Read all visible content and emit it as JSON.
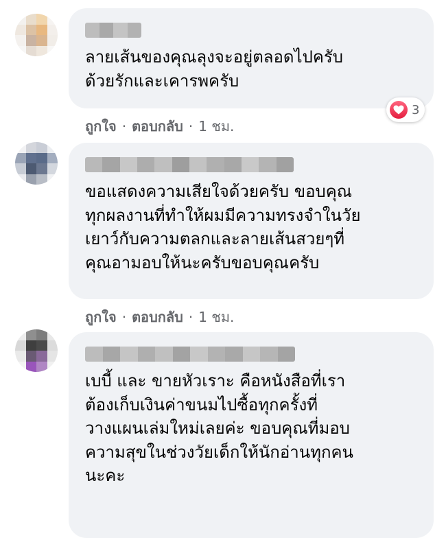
{
  "comments": [
    {
      "text": "ลายเส้นของคุณลุงจะอยู่ตลอดไปครับ\nด้วยรักและเคารพครับ",
      "reaction": {
        "icon": "heart-icon",
        "count": "3",
        "color": "#e41e3f"
      },
      "actions": {
        "like": "ถูกใจ",
        "sep1": "·",
        "reply": "ตอบกลับ",
        "sep2": "·",
        "time": "1 ชม."
      }
    },
    {
      "text": "ขอแสดงความเสียใจด้วยครับ ขอบคุณ\nทุกผลงานที่ทำให้ผมมีความทรงจำในวัย\nเยาว์กับความตลกและลายเส้นสวยๆที่\nคุณอามอบให้นะครับขอบคุณครับ",
      "actions": {
        "like": "ถูกใจ",
        "sep1": "·",
        "reply": "ตอบกลับ",
        "sep2": "·",
        "time": "1 ชม."
      }
    },
    {
      "text": "เบบี้ และ ขายหัวเราะ คือหนังสือที่เรา\nต้องเก็บเงินค่าขนมไปซื้อทุกครั้งที่\nวางแผนเล่มใหม่เลยค่ะ ขอบคุณที่มอบ\nความสุขในช่วงวัยเด็กให้นักอ่านทุกคน\nนะคะ"
    }
  ],
  "colors": {
    "bubble": "#f0f2f5",
    "meta_text": "#65676b",
    "text": "#050505"
  }
}
